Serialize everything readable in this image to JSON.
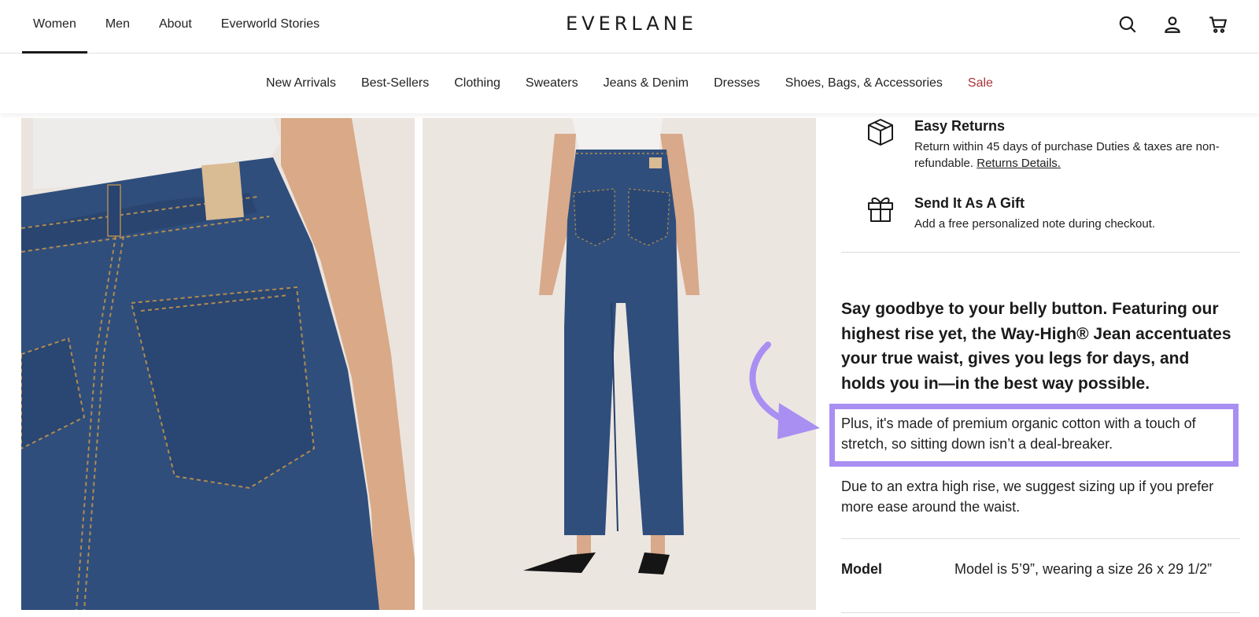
{
  "header": {
    "nav": [
      "Women",
      "Men",
      "About",
      "Everworld Stories"
    ],
    "active_nav": "Women",
    "logo": "EVERLANE",
    "icons": [
      "search-icon",
      "account-icon",
      "cart-icon"
    ]
  },
  "categories": [
    "New Arrivals",
    "Best-Sellers",
    "Clothing",
    "Sweaters",
    "Jeans & Denim",
    "Dresses",
    "Shoes, Bags, & Accessories",
    "Sale"
  ],
  "perks": [
    {
      "icon": "box-icon",
      "title": "Easy Returns",
      "text": "Return within 45 days of purchase Duties & taxes are non-refundable.",
      "link": "Returns Details."
    },
    {
      "icon": "gift-icon",
      "title": "Send It As A Gift",
      "text": "Add a free personalized note during checkout."
    }
  ],
  "description": {
    "lead": "Say goodbye to your belly button. Featuring our highest rise yet, the Way-High® Jean accentuates your true waist, gives you legs for days, and holds you in—in the best way possible.",
    "highlighted": "Plus, it's made of premium organic cotton with a touch of stretch, so sitting down isn’t a deal-breaker.",
    "fit_note": "Due to an extra high rise, we suggest sizing up if you prefer more ease around the waist."
  },
  "details": {
    "model_label": "Model",
    "model_value": "Model is 5’9”, wearing a size 26 x 29 1/2”"
  },
  "colors": {
    "highlight": "#a98ff2",
    "sale": "#a9333a",
    "denim": "#2c4a76"
  }
}
